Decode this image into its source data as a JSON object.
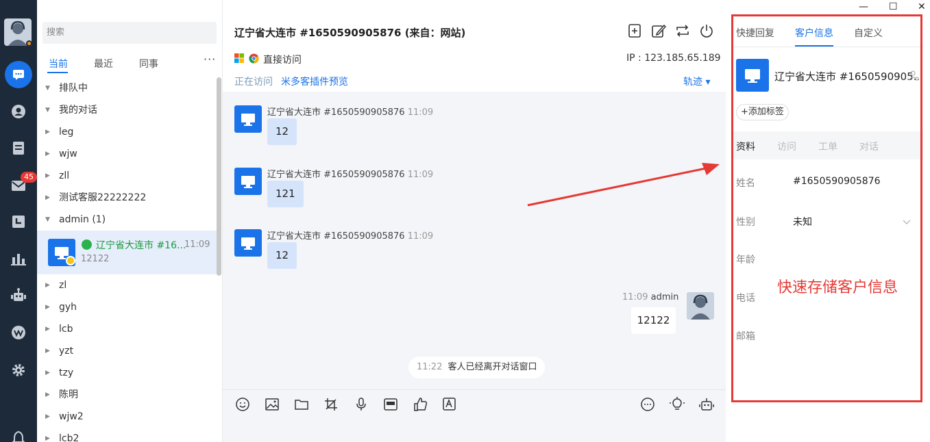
{
  "window": {
    "minimize_glyph": "—",
    "maximize_glyph": "☐",
    "close_glyph": "✕"
  },
  "nav": {
    "items": [
      "chat-icon",
      "user-icon",
      "ticket-icon",
      "mail-icon",
      "clock-icon",
      "chart-icon",
      "robot-icon",
      "plugin-icon",
      "settings-icon",
      "bell-icon"
    ],
    "mail_badge": "45",
    "colors": {
      "rail": "#1c2a39",
      "active": "#1a73e8",
      "badge": "#e53935"
    }
  },
  "sidebar": {
    "search_placeholder": "搜索",
    "tabs": [
      "当前",
      "最近",
      "同事"
    ],
    "more": "···",
    "groups": [
      {
        "label": "排队中",
        "expanded": true
      },
      {
        "label": "我的对话",
        "expanded": true
      },
      {
        "label": "leg",
        "expanded": false
      },
      {
        "label": "wjw",
        "expanded": false
      },
      {
        "label": "zll",
        "expanded": false
      },
      {
        "label": "测试客服22222222",
        "expanded": false
      },
      {
        "label": "admin  (1)",
        "expanded": true
      }
    ],
    "session": {
      "title": "辽宁省大连市 #16...",
      "time": "11:09",
      "last_message": "12122"
    },
    "groups_after": [
      {
        "label": "zl"
      },
      {
        "label": "gyh"
      },
      {
        "label": "lcb"
      },
      {
        "label": "yzt"
      },
      {
        "label": "tzy"
      },
      {
        "label": "陈明"
      },
      {
        "label": "wjw2"
      },
      {
        "label": "lcb2"
      }
    ]
  },
  "chat": {
    "title": "辽宁省大连市 #1650590905876 (来自：网站)",
    "header_icons": [
      "add-icon",
      "edit-icon",
      "transfer-icon",
      "power-icon"
    ],
    "browser_label": "直接访问",
    "ip": "IP : 123.185.65.189",
    "visiting_label": "正在访问",
    "plugin_preview": "米多客插件预览",
    "track_label": "轨迹 ▾",
    "messages": [
      {
        "sender": "辽宁省大连市 #1650590905876",
        "time": "11:09",
        "text": "12"
      },
      {
        "sender": "辽宁省大连市 #1650590905876",
        "time": "11:09",
        "text": "121"
      },
      {
        "sender": "辽宁省大连市 #1650590905876",
        "time": "11:09",
        "text": "12"
      }
    ],
    "agent_message": {
      "sender": "admin",
      "time": "11:09",
      "text": "12122"
    },
    "system_message": {
      "time": "11:22",
      "text": "客人已经离开对话窗口"
    },
    "toolbar_icons": [
      "emoji-icon",
      "image-icon",
      "folder-icon",
      "crop-icon",
      "mic-icon",
      "screen-icon",
      "like-icon",
      "translate-icon",
      "comment-icon",
      "bulb-icon",
      "robot-icon"
    ]
  },
  "panel": {
    "tabs": [
      "快捷回复",
      "客户信息",
      "自定义"
    ],
    "active_tab": "客户信息",
    "customer_name": "辽宁省大连市 #1650590905...",
    "add_tag": "+添加标签",
    "subtabs": [
      "资料",
      "访问",
      "工单",
      "对话"
    ],
    "fields": [
      {
        "label": "姓名",
        "value": "#1650590905876"
      },
      {
        "label": "性别",
        "value": "未知"
      },
      {
        "label": "年龄",
        "value": ""
      },
      {
        "label": "电话",
        "value": ""
      },
      {
        "label": "邮箱",
        "value": ""
      }
    ]
  },
  "annotation": {
    "text": "快速存储客户信息",
    "color": "#e53935"
  }
}
